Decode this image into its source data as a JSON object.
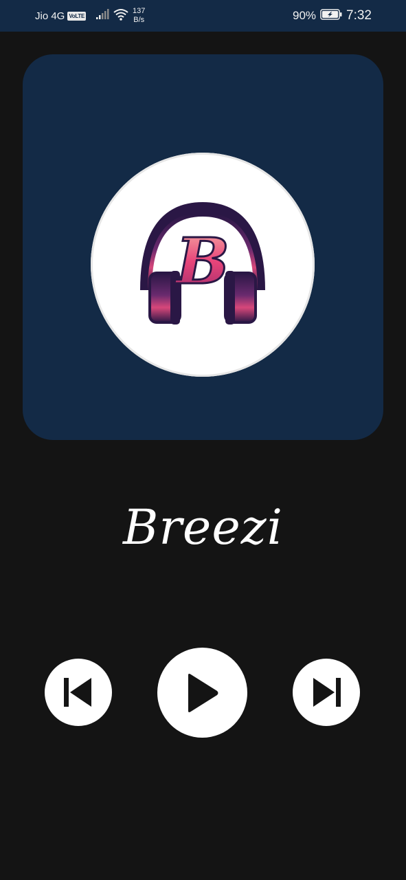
{
  "status_bar": {
    "carrier": "Jio 4G",
    "volte_badge": "VoLTE",
    "net_speed_value": "137",
    "net_speed_unit": "B/s",
    "battery_percent": "90%",
    "time": "7:32",
    "icons": [
      "signal-icon",
      "wifi-icon",
      "battery-charging-icon"
    ]
  },
  "player": {
    "logo_letter": "B",
    "title": "Breezi",
    "controls": [
      "previous-icon",
      "play-icon",
      "next-icon"
    ]
  },
  "colors": {
    "background": "#141414",
    "card": "#132a46",
    "status_bar": "#132a46",
    "accent_pink": "#e8457a",
    "accent_purple": "#3a1b5c"
  }
}
